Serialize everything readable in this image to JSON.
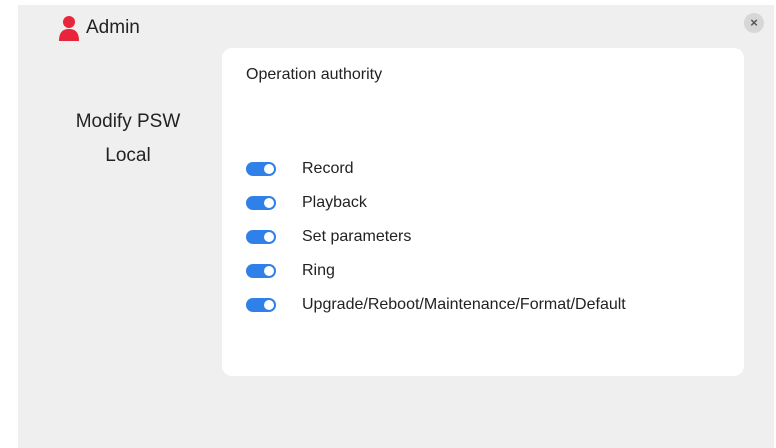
{
  "header": {
    "title": "Admin",
    "icon": "user-icon",
    "close_icon": "close-icon",
    "close_glyph": "×"
  },
  "side_menu": {
    "items": [
      {
        "label": "Modify PSW"
      },
      {
        "label": "Local"
      }
    ]
  },
  "panel": {
    "title": "Operation authority",
    "permissions": [
      {
        "label": "Record",
        "enabled": true
      },
      {
        "label": "Playback",
        "enabled": true
      },
      {
        "label": "Set parameters",
        "enabled": true
      },
      {
        "label": "Ring",
        "enabled": true
      },
      {
        "label": "Upgrade/Reboot/Maintenance/Format/Default",
        "enabled": true
      }
    ]
  },
  "colors": {
    "accent": "#2f80e8",
    "user_icon": "#e8253a",
    "background": "#efefef",
    "panel": "#ffffff"
  }
}
